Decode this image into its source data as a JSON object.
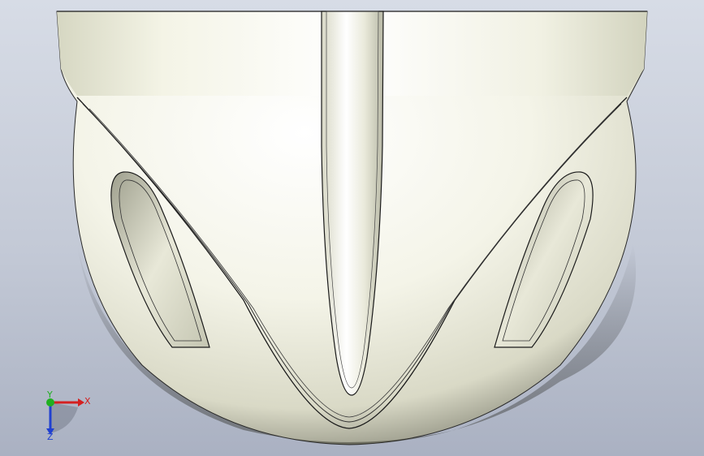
{
  "viewport": {
    "background_top": "#d7dce6",
    "background_bottom": "#aab1c2"
  },
  "model": {
    "body_color": "#f3f3e7",
    "edge_color": "#1a1a1a",
    "shadow_color": "#5a5b50"
  },
  "triad": {
    "x_label": "X",
    "y_label": "Y",
    "z_label": "Z",
    "x_color": "#d42020",
    "y_color": "#20b020",
    "z_color": "#2040d0"
  }
}
